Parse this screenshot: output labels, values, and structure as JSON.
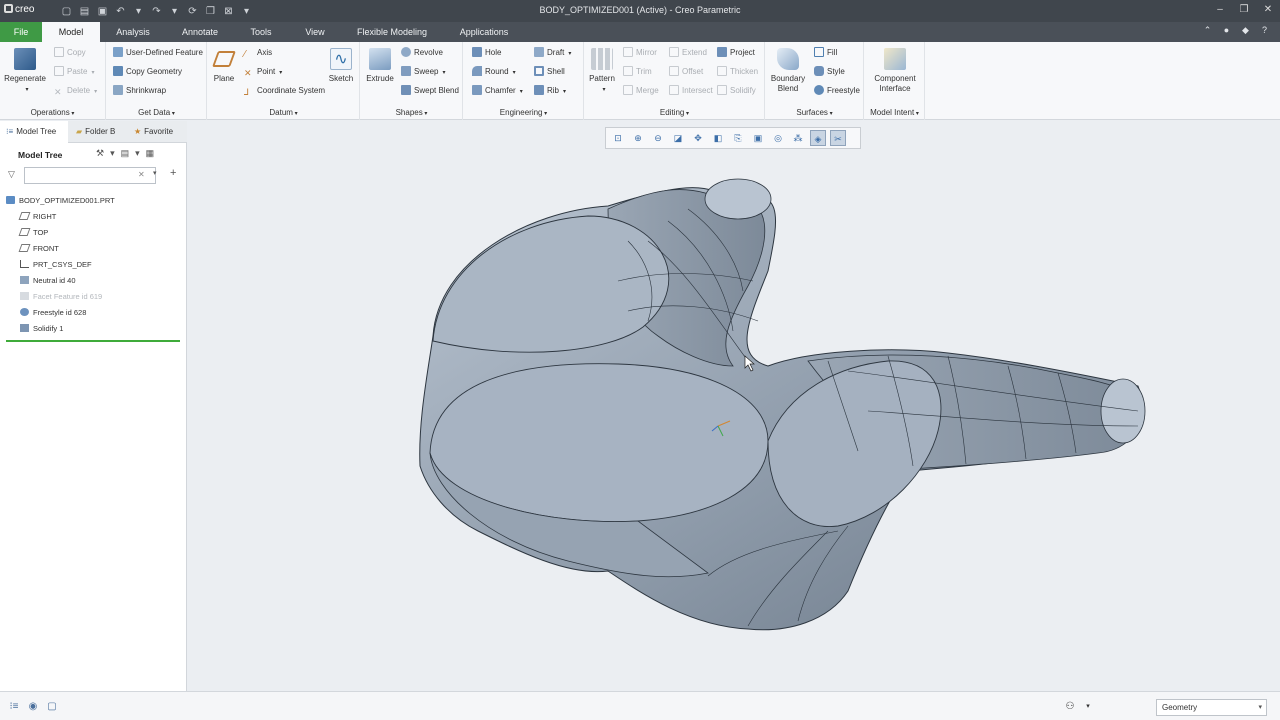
{
  "app": {
    "logo": "creo",
    "window_title": "BODY_OPTIMIZED001 (Active) - Creo Parametric"
  },
  "tabs": [
    {
      "label": "File"
    },
    {
      "label": "Model"
    },
    {
      "label": "Analysis"
    },
    {
      "label": "Annotate"
    },
    {
      "label": "Tools"
    },
    {
      "label": "View"
    },
    {
      "label": "Flexible Modeling"
    },
    {
      "label": "Applications"
    }
  ],
  "ribbon": {
    "operations": {
      "label": "Operations",
      "regenerate": "Regenerate",
      "copy": "Copy",
      "paste": "Paste",
      "delete": "Delete"
    },
    "getdata": {
      "label": "Get Data",
      "udf": "User-Defined Feature",
      "copy_geometry": "Copy Geometry",
      "shrinkwrap": "Shrinkwrap"
    },
    "datum": {
      "label": "Datum",
      "plane": "Plane",
      "axis": "Axis",
      "point": "Point",
      "csys": "Coordinate System",
      "sketch": "Sketch"
    },
    "shapes": {
      "label": "Shapes",
      "extrude": "Extrude",
      "revolve": "Revolve",
      "sweep": "Sweep",
      "swept_blend": "Swept Blend"
    },
    "engineering": {
      "label": "Engineering",
      "hole": "Hole",
      "round": "Round",
      "chamfer": "Chamfer",
      "draft": "Draft",
      "shell": "Shell",
      "rib": "Rib"
    },
    "editing": {
      "label": "Editing",
      "pattern": "Pattern",
      "mirror": "Mirror",
      "trim": "Trim",
      "merge": "Merge",
      "extend": "Extend",
      "offset": "Offset",
      "intersect": "Intersect",
      "project": "Project",
      "thicken": "Thicken",
      "solidify": "Solidify"
    },
    "surfaces": {
      "label": "Surfaces",
      "boundary_blend_1": "Boundary",
      "boundary_blend_2": "Blend",
      "fill": "Fill",
      "style": "Style",
      "freestyle": "Freestyle"
    },
    "model_intent": {
      "label": "Model Intent",
      "component_interface_1": "Component",
      "component_interface_2": "Interface"
    }
  },
  "panel": {
    "tabs": [
      "Model Tree",
      "Folder B",
      "Favorite"
    ],
    "header": "Model Tree",
    "search_value": "",
    "items": [
      {
        "label": "BODY_OPTIMIZED001.PRT",
        "icon": "part-icon",
        "dim": false,
        "indent": 0
      },
      {
        "label": "RIGHT",
        "icon": "datum-plane-icon",
        "dim": false,
        "indent": 1
      },
      {
        "label": "TOP",
        "icon": "datum-plane-icon",
        "dim": false,
        "indent": 1
      },
      {
        "label": "FRONT",
        "icon": "datum-plane-icon",
        "dim": false,
        "indent": 1
      },
      {
        "label": "PRT_CSYS_DEF",
        "icon": "csys-icon",
        "dim": false,
        "indent": 1
      },
      {
        "label": "Neutral id 40",
        "icon": "neutral-feature-icon",
        "dim": false,
        "indent": 1
      },
      {
        "label": "Facet Feature id 619",
        "icon": "facet-feature-icon",
        "dim": true,
        "indent": 1
      },
      {
        "label": "Freestyle id 628",
        "icon": "freestyle-icon",
        "dim": false,
        "indent": 1
      },
      {
        "label": "Solidify 1",
        "icon": "solidify-icon",
        "dim": false,
        "indent": 1
      }
    ]
  },
  "statusbar": {
    "selection_filter": "Geometry"
  },
  "colors": {
    "titlebar": "#40464d",
    "tabbar": "#4a5058",
    "file_tab": "#3f9a45",
    "model_fill": "#a9b6c5",
    "insert_indicator": "#3fab3a"
  }
}
